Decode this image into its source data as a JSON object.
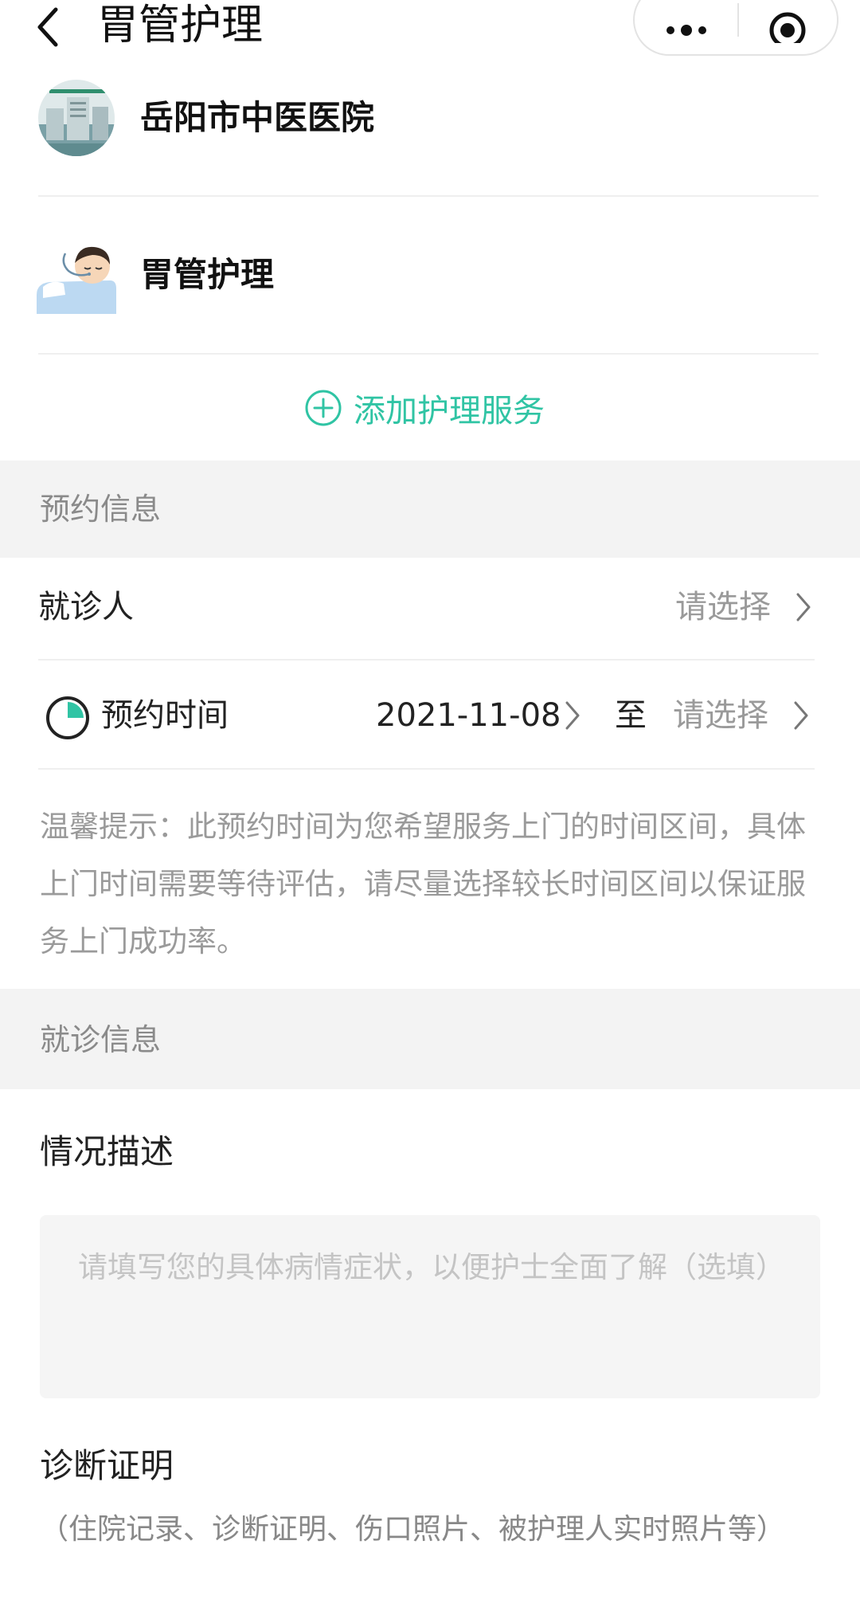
{
  "header": {
    "title": "胃管护理",
    "back_icon": "chevron-left-icon",
    "more_icon": "more-dots-icon",
    "close_icon": "target-circle-icon"
  },
  "hospital": {
    "name": "岳阳市中医医院"
  },
  "service": {
    "name": "胃管护理",
    "icon": "patient-with-tube-icon"
  },
  "add_service": {
    "label": "添加护理服务",
    "icon": "plus-circle-icon",
    "color": "#30c4a4"
  },
  "appointment_section": {
    "title": "预约信息",
    "patient_row": {
      "label": "就诊人",
      "value": "请选择"
    },
    "time_row": {
      "label": "预约时间",
      "start": "2021-11-08",
      "separator": "至",
      "end": "请选择"
    },
    "tip": "温馨提示：此预约时间为您希望服务上门的时间区间，具体上门时间需要等待评估，请尽量选择较长时间区间以保证服务上门成功率。"
  },
  "visit_section": {
    "title": "就诊信息",
    "description": {
      "title": "情况描述",
      "placeholder": "请填写您的具体病情症状，以便护士全面了解（选填）"
    },
    "certificate": {
      "title": "诊断证明",
      "subtitle": "（住院记录、诊断证明、伤口照片、被护理人实时照片等）"
    }
  }
}
